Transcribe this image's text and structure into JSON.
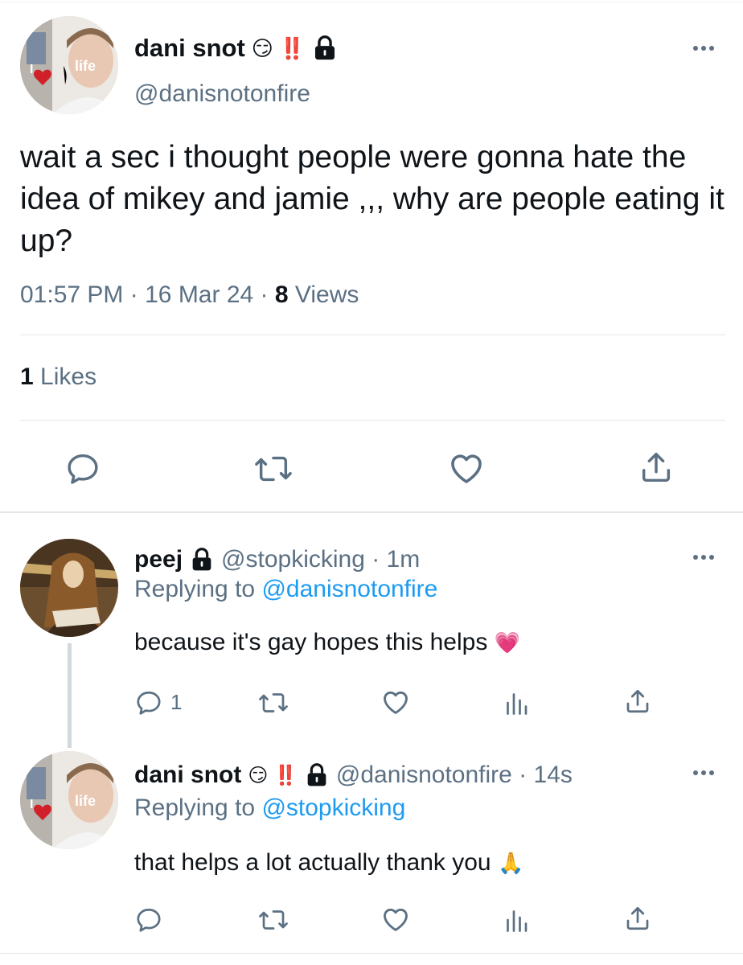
{
  "main_tweet": {
    "display_name": "dani snot",
    "emoji": "😏 ‼️",
    "handle": "@danisnotonfire",
    "avatar_text": {
      "left": "I",
      "right": "life"
    },
    "body": "wait a sec i thought people were gonna hate the idea of mikey and jamie ,,, why are people eating it up?",
    "time": "01:57 PM",
    "date": "16 Mar 24",
    "separator": "·",
    "views_count": "8",
    "views_label": "Views",
    "likes_count": "1",
    "likes_label": "Likes"
  },
  "reply_1": {
    "display_name": "peej",
    "handle_time": "@stopkicking · 1m",
    "replying_prefix": "Replying to",
    "replying_to": "@danisnotonfire",
    "body": "because it's gay hopes this helps",
    "body_emoji": "💗",
    "reply_count": "1"
  },
  "reply_2": {
    "display_name": "dani snot",
    "emoji": "😏 ‼️",
    "handle_time": "@danisnotonfire · 14s",
    "replying_prefix": "Replying to",
    "replying_to": "@stopkicking",
    "body": "that helps a lot actually thank you",
    "body_emoji": "🙏",
    "avatar_text": {
      "left": "I",
      "right": "life"
    }
  },
  "icons": {
    "more": "more-horizontal-icon",
    "reply": "reply-bubble-icon",
    "retweet": "retweet-icon",
    "like": "heart-icon",
    "share": "share-upload-icon",
    "analytics": "analytics-bars-icon",
    "lock": "lock-icon"
  },
  "colors": {
    "text": "#0f1419",
    "muted": "#5b7083",
    "link": "#1d9bf0",
    "divider": "#e1e6ea",
    "thread_line": "#cfd9de"
  }
}
